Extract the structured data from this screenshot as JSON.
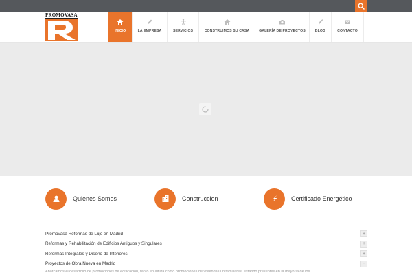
{
  "colors": {
    "accent": "#e9742b",
    "topbar": "#55585c",
    "slider_bg": "#ebebeb"
  },
  "topbar": {
    "search_icon": "search-icon"
  },
  "logo": {
    "text": "PROMOVASA"
  },
  "nav": {
    "items": [
      {
        "label": "INICIO",
        "icon": "home-icon",
        "active": true
      },
      {
        "label": "LA EMPRESA",
        "icon": "pencil-icon",
        "active": false
      },
      {
        "label": "SERVICIOS",
        "icon": "person-icon",
        "active": false
      },
      {
        "label": "CONSTRUIMOS SU CASA",
        "icon": "house-icon",
        "active": false
      },
      {
        "label": "GALERÍA DE PROYECTOS",
        "icon": "camera-icon",
        "active": false
      },
      {
        "label": "BLOG",
        "icon": "quill-icon",
        "active": false
      },
      {
        "label": "CONTACTO",
        "icon": "envelope-icon",
        "active": false
      }
    ]
  },
  "slider": {
    "loader_icon": "loading-spinner-icon"
  },
  "features": [
    {
      "title": "Quienes Somos",
      "icon": "user-icon"
    },
    {
      "title": "Construccion",
      "icon": "building-icon"
    },
    {
      "title": "Certificado Energético",
      "icon": "lightning-icon"
    }
  ],
  "accordion": {
    "items": [
      {
        "label": "Promovasa Reformas de Lujo en Madrid",
        "toggle": "+"
      },
      {
        "label": "Reformas y Rehabilitación de Edificios Antiguos y Singulares",
        "toggle": "+"
      },
      {
        "label": "Reformas Integrales y Diseño de Interiores",
        "toggle": "+"
      },
      {
        "label": "Proyectos de Obra Nueva en Madrid",
        "toggle": "-"
      }
    ],
    "body_text": "Abarcamos el desarrollo de promociones de edificación, tanto en altura como promociones de viviendas unifamiliares, estando presentes en la mayoría de los"
  }
}
